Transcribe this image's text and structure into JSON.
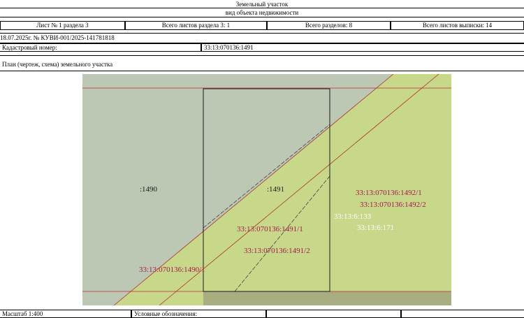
{
  "header": {
    "title": "Земельный участок",
    "subtitle": "вид объекта недвижимости",
    "sheet": "Лист № 1 раздела 3",
    "sheets_section": "Всего листов раздела 3: 1",
    "sections": "Всего разделов: 8",
    "sheets_total": "Всего листов выписки: 14"
  },
  "doc_ref": "18.07.2025г. № КУВИ-001/2025-141781818",
  "cadastral": {
    "label": "Кадастровый номер:",
    "value": "33:13:070136:1491"
  },
  "plan_title": "План (чертеж, схема) земельного участка",
  "map_labels": {
    "p1490": ":1490",
    "p1491": ":1491",
    "p1492_1": "33:13:070136:1492/1",
    "p1492_2": "33:13:070136:1492/2",
    "p6_133": "33:13:6:133",
    "p6_171": "33:13:6:171",
    "p1491_1": "33:13:070136:1491/1",
    "p1491_2": "33:13:070136:1491/2",
    "p1490_1": "33:13:070136:1490/1"
  },
  "footer": {
    "scale": "Масштаб 1:400",
    "legend": "Условные обозначения:"
  },
  "colors": {
    "map_green": "#c8d88a",
    "map_gray": "#bcc8b4",
    "red_line": "#b03030",
    "label_red": "#a3184e"
  }
}
